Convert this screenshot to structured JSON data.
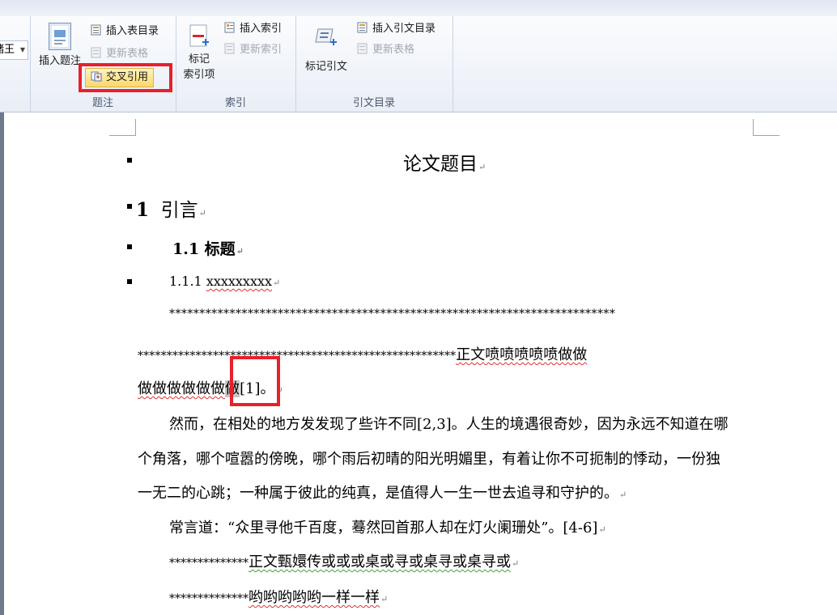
{
  "ribbon": {
    "partial_label": "储王",
    "caption_group": {
      "label": "题注",
      "insert_caption": "插入题注",
      "insert_table_of_figures": "插入表目录",
      "update_table": "更新表格",
      "cross_reference": "交叉引用"
    },
    "index_group": {
      "label": "索引",
      "mark_entry_line1": "标记",
      "mark_entry_line2": "索引项",
      "insert_index": "插入索引",
      "update_index": "更新索引"
    },
    "citation_group": {
      "label": "引文目录",
      "mark_citation": "标记引文",
      "insert_table_of_authorities": "插入引文目录",
      "update_table": "更新表格"
    },
    "accent_colors": {
      "highlight": "#e8202a",
      "selected_button": "#fce592"
    }
  },
  "document": {
    "title": "论文题目",
    "heading1_num": "1",
    "heading1_text": "引言",
    "heading2": "1.1 标题",
    "heading3_num": "1.1.1",
    "heading3_text": "xxxxxxxxx",
    "para1_line1": "**************************************************************************",
    "para1_line2_stars": "*******************************************************",
    "para1_line2_text": "正文喷喷喷喷喷做做",
    "para1_line3_text": "做做做做做做",
    "para1_line3_sel": "做",
    "para1_line3_ref": "[1]",
    "para1_line3_end": "。",
    "para2_line1": "然而，在相处的地方发发现了些许不同[2,3]。人生的境遇很奇妙，因为永远不知道在哪",
    "para2_line2": "个角落，哪个喧嚣的傍晚，哪个雨后初晴的阳光明媚里，有着让你不可扼制的悸动，一份独",
    "para2_line3": "一无二的心跳；一种属于彼此的纯真，是值得人一生一世去追寻和守护的。",
    "para3": "常言道：“众里寻他千百度，蓦然回首那人却在灯火阑珊处”。[4-6]",
    "para4_stars": "**************",
    "para4_text": "正文甄嬛传或或或桌或寻或桌寻或桌寻或",
    "para5_stars": "**************",
    "para5_text": "哟哟哟哟哟一样一样"
  }
}
